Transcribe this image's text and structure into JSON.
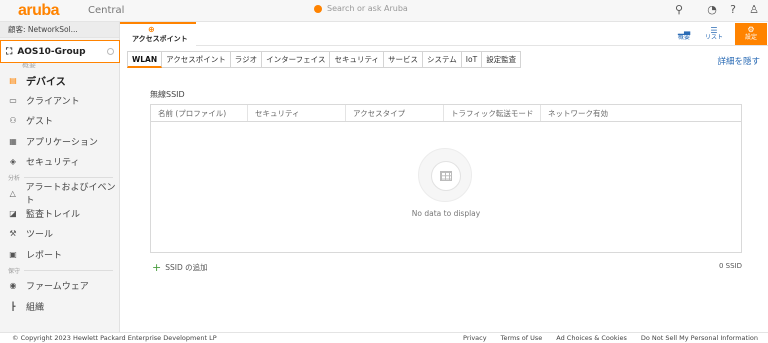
{
  "app": {
    "brand": "aruba",
    "product": "Central"
  },
  "search": {
    "placeholder": "Search or ask Aruba"
  },
  "customer_label": "顧客: NetworkSol...",
  "group_name": "AOS10-Group",
  "context": {
    "tab_label": "アクセスポイント",
    "summary_label": "概要",
    "list_label": "リスト",
    "settings_label": "設定"
  },
  "sidebar": {
    "partial_label": "概要",
    "items": [
      {
        "label": "デバイス",
        "icon": "device-icon",
        "glyph": "▤"
      },
      {
        "label": "クライアント",
        "icon": "laptop-icon",
        "glyph": "▭"
      },
      {
        "label": "ゲスト",
        "icon": "users-icon",
        "glyph": "⚇"
      },
      {
        "label": "アプリケーション",
        "icon": "grid-icon",
        "glyph": "▦"
      },
      {
        "label": "セキュリティ",
        "icon": "shield-icon",
        "glyph": "◈"
      }
    ],
    "section_analysis": "分析",
    "analysis_items": [
      {
        "label": "アラートおよびイベント",
        "icon": "bell-icon",
        "glyph": "△"
      },
      {
        "label": "監査トレイル",
        "icon": "audit-icon",
        "glyph": "◪"
      },
      {
        "label": "ツール",
        "icon": "wrench-icon",
        "glyph": "⚒"
      },
      {
        "label": "レポート",
        "icon": "report-icon",
        "glyph": "▣"
      }
    ],
    "section_maintenance": "保守",
    "maintenance_items": [
      {
        "label": "ファームウェア",
        "icon": "firmware-icon",
        "glyph": "◉"
      },
      {
        "label": "組織",
        "icon": "org-icon",
        "glyph": "┣"
      }
    ]
  },
  "tabs": [
    "WLAN",
    "アクセスポイント",
    "ラジオ",
    "インターフェイス",
    "セキュリティ",
    "サービス",
    "システム",
    "IoT",
    "設定監査"
  ],
  "hide_details": "詳細を隠す",
  "wireless": {
    "title": "無線SSID",
    "columns": [
      "名前 (プロファイル)",
      "セキュリティ",
      "アクセスタイプ",
      "トラフィック転送モード",
      "ネットワーク有効"
    ],
    "empty_text": "No data to display",
    "add_label": "SSID の追加",
    "count_label": "0 SSID"
  },
  "footer": {
    "copyright": "© Copyright 2023 Hewlett Packard Enterprise Development LP",
    "links": [
      "Privacy",
      "Terms of Use",
      "Ad Choices & Cookies",
      "Do Not Sell My Personal Information"
    ]
  },
  "colors": {
    "accent": "#ff8300",
    "link": "#2a6bb5"
  }
}
